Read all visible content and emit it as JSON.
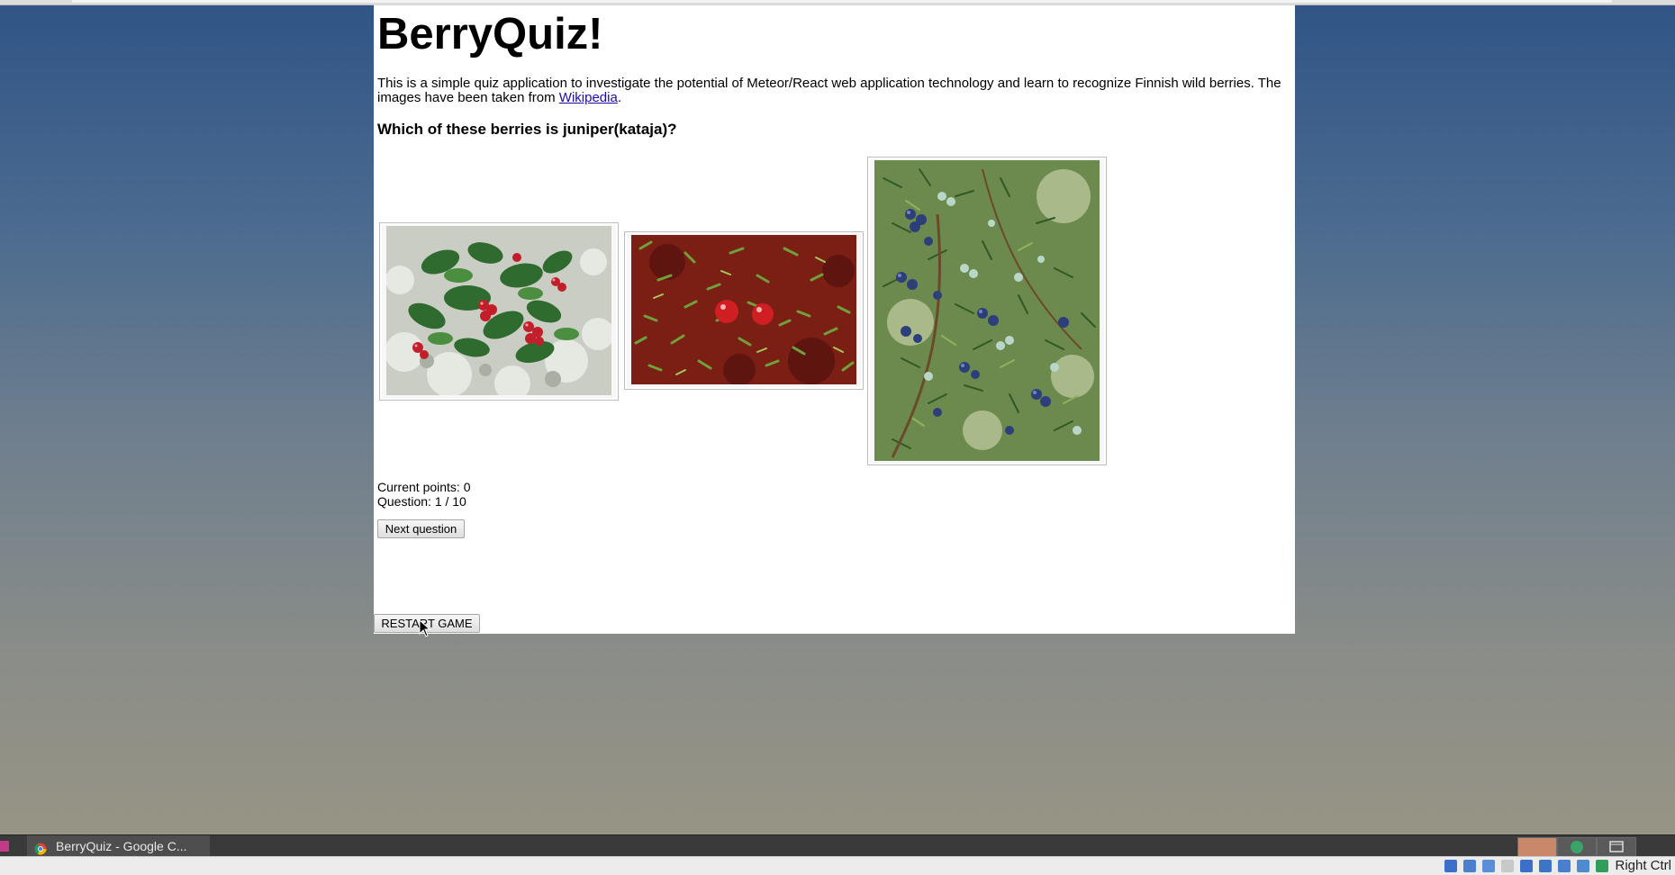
{
  "app": {
    "title": "BerryQuiz!",
    "description_prefix": "This is a simple quiz application to investigate the potential of Meteor/React web application technology and learn to recognize Finnish wild berries. The images have been taken from ",
    "description_link": "Wikipedia",
    "description_suffix": ".",
    "question": "Which of these berries is juniper(kataja)?"
  },
  "stats": {
    "points": "Current points: 0",
    "question": "Question: 1 / 10"
  },
  "buttons": {
    "next": "Next question",
    "restart": "RESTART GAME"
  },
  "images": [
    {
      "name": "lingonberry-image",
      "subject": "red lingonberries among green leaves and white lichen"
    },
    {
      "name": "cranberry-image",
      "subject": "two red cranberries on red moss"
    },
    {
      "name": "juniper-image",
      "subject": "blue juniper berries on green needles"
    }
  ],
  "taskbar": {
    "window_title": "BerryQuiz - Google C...",
    "host_key": "Right Ctrl"
  },
  "colors": {
    "link": "#1a0dab",
    "taskbar": "#3a3a3a"
  }
}
